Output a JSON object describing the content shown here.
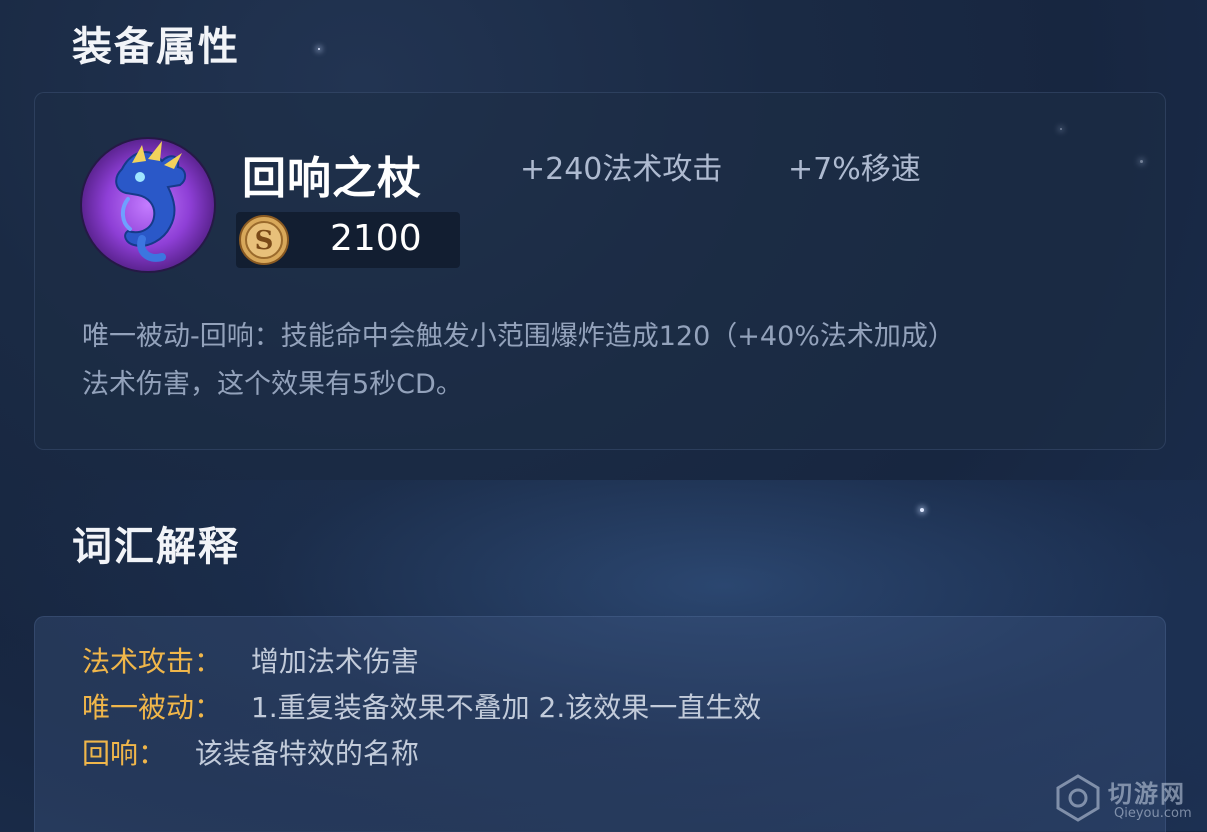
{
  "attributes_section": {
    "title": "装备属性"
  },
  "item": {
    "name": "回响之杖",
    "icon": "dragon-staff-icon",
    "stats": [
      "+240法术攻击",
      "+7%移速"
    ],
    "price": "2100",
    "price_icon": "gold-coin-icon",
    "description_lines": [
      "唯一被动-回响：技能命中会触发小范围爆炸造成120（+40%法术加成）",
      "法术伤害，这个效果有5秒CD。"
    ]
  },
  "glossary_section": {
    "title": "词汇解释",
    "entries": [
      {
        "term": "法术攻击：",
        "definition": "增加法术伤害"
      },
      {
        "term": "唯一被动：",
        "definition": "1.重复装备效果不叠加 2.该效果一直生效"
      },
      {
        "term": "回响：",
        "definition": "该装备特效的名称"
      }
    ]
  },
  "watermark": {
    "text": "切游网",
    "sub": "Qieyou.com"
  },
  "colors": {
    "term_gold": "#f0b64a",
    "background": "#1a2a44",
    "icon_purple": "#8e3fd6"
  }
}
